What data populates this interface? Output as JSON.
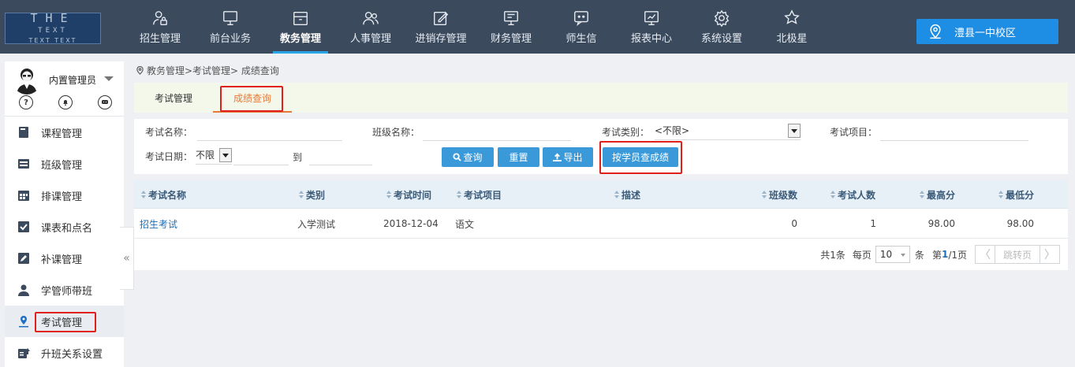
{
  "logo": {
    "line1": "THE",
    "line2": "TEXT",
    "tagline": "TEXT TEXT"
  },
  "nav": [
    {
      "label": "招生管理",
      "icon": "user-lock-icon"
    },
    {
      "label": "前台业务",
      "icon": "monitor-icon"
    },
    {
      "label": "教务管理",
      "icon": "box-icon",
      "active": true
    },
    {
      "label": "人事管理",
      "icon": "users-icon"
    },
    {
      "label": "进销存管理",
      "icon": "edit-icon"
    },
    {
      "label": "财务管理",
      "icon": "register-icon"
    },
    {
      "label": "师生信",
      "icon": "message-icon"
    },
    {
      "label": "报表中心",
      "icon": "chart-icon"
    },
    {
      "label": "系统设置",
      "icon": "gear-icon"
    },
    {
      "label": "北极星",
      "icon": "star-icon"
    }
  ],
  "campus": {
    "label": "澧县一中校区",
    "icon": "location-icon"
  },
  "user": {
    "name": "内置管理员",
    "icons": [
      "help-icon",
      "bell-icon",
      "chat-icon"
    ]
  },
  "sidebar": {
    "items": [
      {
        "label": "课程管理",
        "icon": "book-icon"
      },
      {
        "label": "班级管理",
        "icon": "class-icon"
      },
      {
        "label": "排课管理",
        "icon": "calendar-icon"
      },
      {
        "label": "课表和点名",
        "icon": "check-icon"
      },
      {
        "label": "补课管理",
        "icon": "pencil-icon"
      },
      {
        "label": "学管师带班",
        "icon": "teacher-icon"
      },
      {
        "label": "考试管理",
        "icon": "pin-icon",
        "active": true
      },
      {
        "label": "升班关系设置",
        "icon": "upgrade-icon"
      }
    ],
    "collapse": "«"
  },
  "breadcrumb": "教务管理>考试管理> 成绩查询",
  "subtabs": [
    {
      "label": "考试管理"
    },
    {
      "label": "成绩查询",
      "active": true
    }
  ],
  "filter": {
    "exam_name_label": "考试名称：",
    "class_name_label": "班级名称：",
    "exam_type_label": "考试类别：",
    "exam_type_value": "<不限>",
    "exam_item_label": "考试项目：",
    "exam_date_label": "考试日期：",
    "exam_date_value": "不限",
    "to_label": "到",
    "btn_query": "查询",
    "btn_reset": "重置",
    "btn_export": "导出",
    "btn_by_student": "按学员查成绩"
  },
  "table": {
    "columns": [
      "考试名称",
      "类别",
      "考试时间",
      "考试项目",
      "描述",
      "班级数",
      "考试人数",
      "最高分",
      "最低分"
    ],
    "rows": [
      [
        "招生考试",
        "入学测试",
        "2018-12-04",
        "语文",
        "",
        "0",
        "1",
        "98.00",
        "98.00"
      ]
    ]
  },
  "pager": {
    "total": "共1条",
    "per_page_label": "每页",
    "per_page": "10",
    "unit": "条",
    "page_prefix": "第",
    "page_current": "1",
    "page_suffix": "/1页",
    "prev": "〈",
    "jump": "跳转页",
    "next": "〉"
  },
  "colors": {
    "topbar": "#3c4a5e",
    "accent": "#1e8de4",
    "button": "#3a9ad9",
    "tab_active": "#e87836",
    "highlight": "#e0201a"
  }
}
